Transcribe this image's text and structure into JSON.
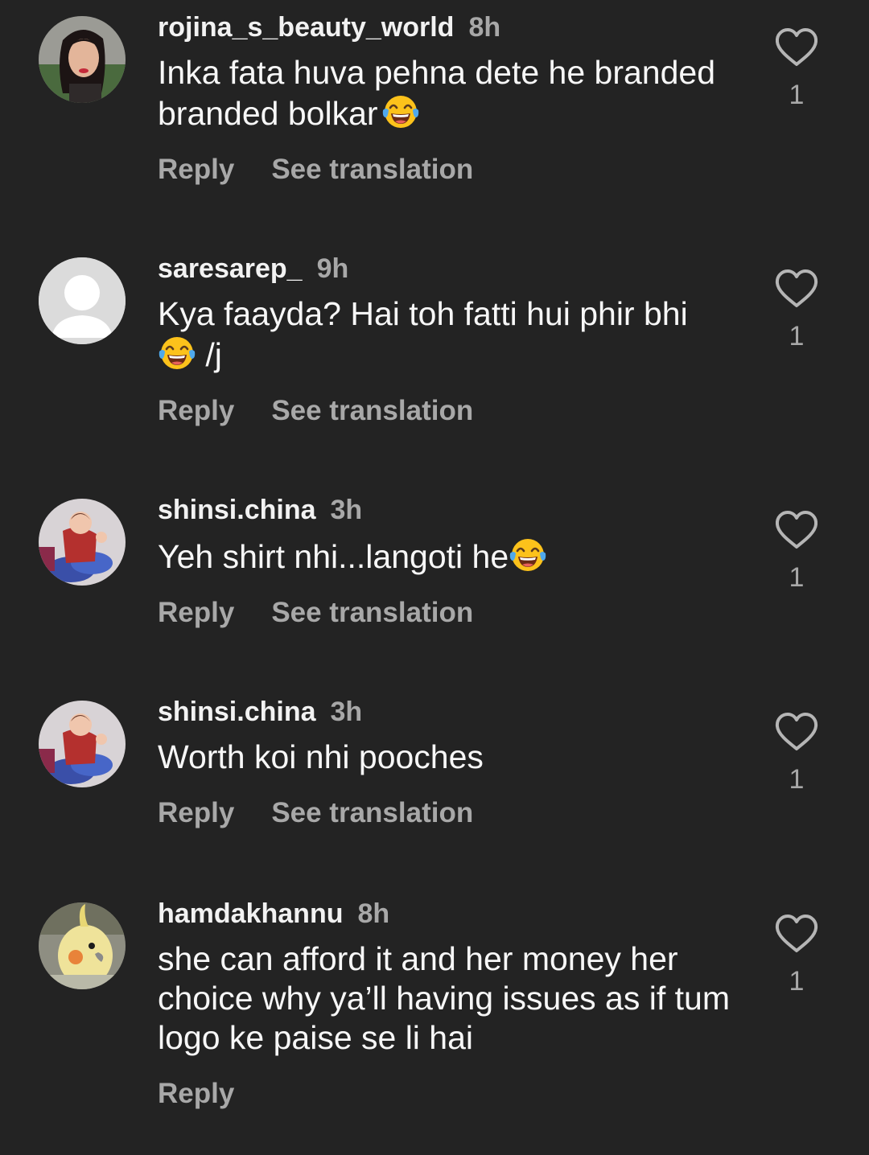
{
  "comments": [
    {
      "username": "rojina_s_beauty_world",
      "time": "8h",
      "text_lines": [
        "Inka fata huva pehna dete he branded",
        "branded bolkar"
      ],
      "emoji": "face-with-tears-of-joy",
      "reply_label": "Reply",
      "translate_label": "See translation",
      "likes": "1"
    },
    {
      "username": "saresarep_",
      "time": "9h",
      "text_lines": [
        "Kya faayda? Hai toh fatti hui phir bhi",
        "/j"
      ],
      "emoji": "face-with-tears-of-joy",
      "reply_label": "Reply",
      "translate_label": "See translation",
      "likes": "1"
    },
    {
      "username": "shinsi.china",
      "time": "3h",
      "text_lines": [
        "Yeh shirt nhi...langoti he"
      ],
      "emoji": "face-with-tears-of-joy",
      "reply_label": "Reply",
      "translate_label": "See translation",
      "likes": "1"
    },
    {
      "username": "shinsi.china",
      "time": "3h",
      "text_lines": [
        "Worth koi nhi pooches"
      ],
      "reply_label": "Reply",
      "translate_label": "See translation",
      "likes": "1"
    },
    {
      "username": "hamdakhannu",
      "time": "8h",
      "text_lines": [
        "she can afford it and her money her",
        "choice why ya’ll having issues as if tum",
        "logo ke paise se li hai"
      ],
      "reply_label": "Reply",
      "likes": "1"
    }
  ],
  "colors": {
    "background": "#232323",
    "text": "#f7f7f7",
    "secondary": "#a8a8a8"
  }
}
